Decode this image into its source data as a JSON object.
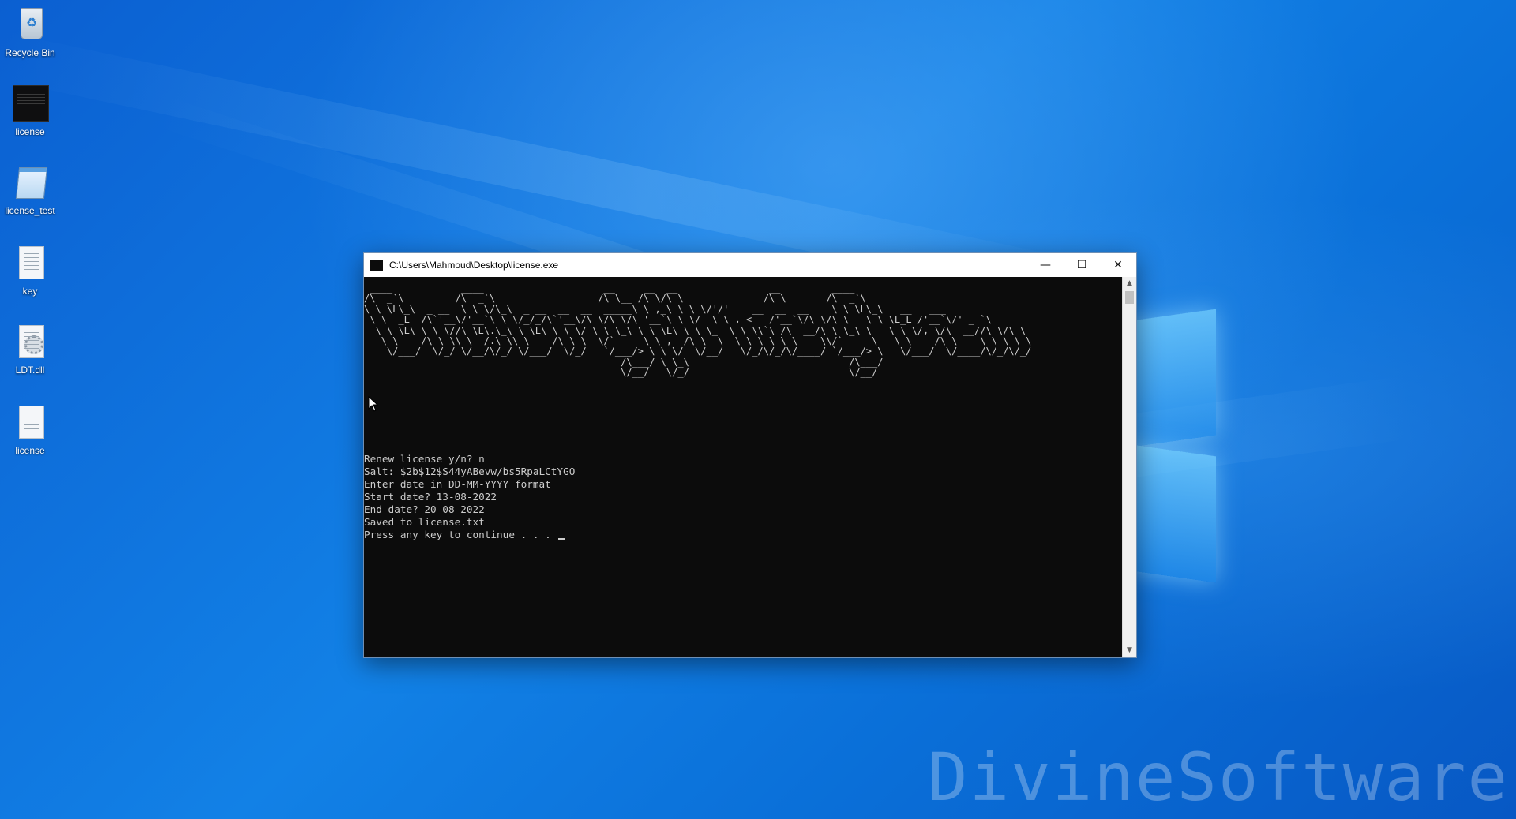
{
  "desktop": {
    "icons": [
      {
        "label": "Recycle Bin",
        "icon": "recycle-bin-icon"
      },
      {
        "label": "license",
        "icon": "console-exe-icon"
      },
      {
        "label": "license_test",
        "icon": "notepad-icon"
      },
      {
        "label": "key",
        "icon": "text-file-icon"
      },
      {
        "label": "LDT.dll",
        "icon": "dll-file-icon"
      },
      {
        "label": "license",
        "icon": "text-file-icon"
      }
    ],
    "watermark": "DivineSoftware",
    "colors": {
      "background": "#0a6fd8",
      "accent": "#78d2ff"
    }
  },
  "console": {
    "title": "C:\\Users\\Mahmoud\\Desktop\\license.exe",
    "controls": {
      "minimize": "—",
      "maximize": "☐",
      "close": "✕"
    },
    "ascii_art": [
      " ____            ____                     __     __  __                __         ____",
      "/\\  _`\\         /\\  _`\\                  /\\ \\__ /\\ \\/\\ \\              /\\ \\       /\\  _`\\",
      "\\ \\ \\L\\_\\  _ __  \\ \\ \\/\\_\\  _ __  __  __  _____\\ \\ ,_\\ \\ \\ \\/'/'    __  __  __    \\ \\ \\L\\_\\   __   ___",
      " \\ \\  _L  /\\`'__\\/'__`\\ \\ \\/_/_/\\`'__\\/\\ \\/\\ \\/\\ '__`\\ \\ \\/  \\ \\ , <   /'__`\\/\\ \\/\\ \\   \\ \\ \\L_L /'__`\\/' _ `\\",
      "  \\ \\ \\L\\ \\ \\ \\//\\ \\L\\.\\_\\ \\ \\L\\ \\ \\ \\/ \\ \\ \\_\\ \\ \\ \\L\\ \\ \\ \\_  \\ \\ \\\\`\\ /\\  __/\\ \\ \\_\\ \\   \\ \\ \\/, \\/\\  __//\\ \\/\\ \\",
      "   \\ \\____/\\ \\_\\\\ \\__/.\\_\\\\ \\____/\\ \\_\\  \\/`____ \\ \\ ,__/\\ \\__\\  \\ \\_\\ \\_\\ \\____\\\\/`____ \\   \\ \\____/\\ \\____\\ \\_\\ \\_\\",
      "    \\/___/  \\/_/ \\/__/\\/_/ \\/___/  \\/_/   `/___/> \\ \\ \\/  \\/__/   \\/_/\\/_/\\/____/ `/___/> \\   \\/___/  \\/____/\\/_/\\/_/",
      "                                             /\\___/ \\ \\_\\                            /\\___/",
      "                                             \\/__/   \\/_/                            \\/__/"
    ],
    "output_lines": [
      "Renew license y/n? n",
      "Salt: $2b$12$S44yABevw/bs5RpaLCtYGO",
      "Enter date in DD-MM-YYYY format",
      "Start date? 13-08-2022",
      "End date? 20-08-2022",
      "Saved to license.txt",
      "Press any key to continue . . . "
    ]
  }
}
